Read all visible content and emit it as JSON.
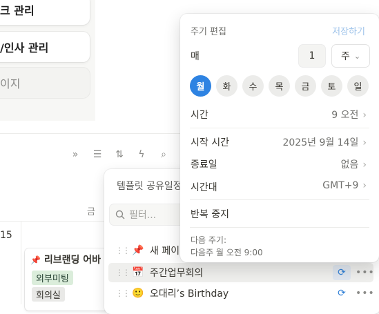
{
  "left_cards": [
    "크 관리",
    "/인사 관리",
    "이지"
  ],
  "toolbar_icons": [
    "double-chevron-icon",
    "filter-icon",
    "sort-icon",
    "lightning-icon",
    "search-icon"
  ],
  "calendar": {
    "day_header": "금",
    "date": "15"
  },
  "event": {
    "title": "리브랜딩 어바",
    "tags": [
      "외부미팅",
      "회의실"
    ]
  },
  "templates": {
    "title": "템플릿 공유일정",
    "filter_placeholder": "필터...",
    "rows": [
      {
        "icon": "📌",
        "label": "새 페이",
        "selected": false,
        "repeat": false
      },
      {
        "icon": "📅",
        "label": "주간업무회의",
        "selected": true,
        "repeat": true
      },
      {
        "icon": "🙂",
        "label": "오대리’s Birthday",
        "selected": false,
        "repeat": true
      }
    ]
  },
  "popup": {
    "title": "주기 편집",
    "save": "저장하기",
    "every_label": "매",
    "every_value": "1",
    "unit": "주",
    "days": [
      "월",
      "화",
      "수",
      "목",
      "금",
      "토",
      "일"
    ],
    "active_day": "월",
    "time_label": "시간",
    "time_value": "9 오전",
    "start_label": "시작 시간",
    "start_value": "2025년 9월 14일",
    "end_label": "종료일",
    "end_value": "없음",
    "tz_label": "시간대",
    "tz_value": "GMT+9",
    "stop_label": "반복 중지",
    "next_label": "다음 주기:",
    "next_value": "다음주 월 오전 9:00"
  }
}
